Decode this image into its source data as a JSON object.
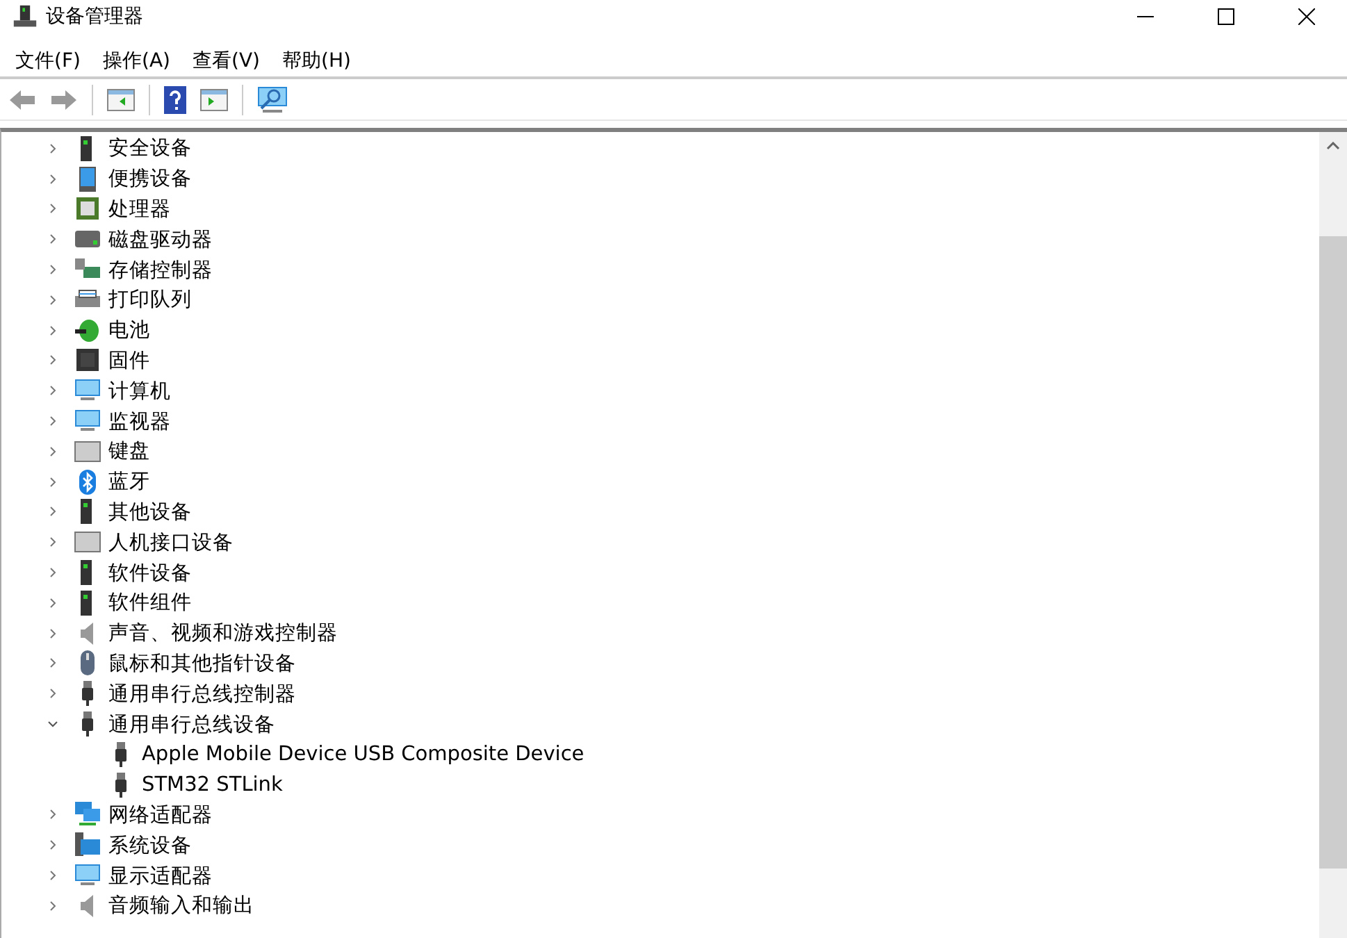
{
  "window": {
    "title": "设备管理器"
  },
  "menu": [
    "文件(F)",
    "操作(A)",
    "查看(V)",
    "帮助(H)"
  ],
  "tree": [
    {
      "label": "安全设备",
      "expanded": false
    },
    {
      "label": "便携设备",
      "expanded": false
    },
    {
      "label": "处理器",
      "expanded": false
    },
    {
      "label": "磁盘驱动器",
      "expanded": false
    },
    {
      "label": "存储控制器",
      "expanded": false
    },
    {
      "label": "打印队列",
      "expanded": false
    },
    {
      "label": "电池",
      "expanded": false
    },
    {
      "label": "固件",
      "expanded": false
    },
    {
      "label": "计算机",
      "expanded": false
    },
    {
      "label": "监视器",
      "expanded": false
    },
    {
      "label": "键盘",
      "expanded": false
    },
    {
      "label": "蓝牙",
      "expanded": false
    },
    {
      "label": "其他设备",
      "expanded": false
    },
    {
      "label": "人机接口设备",
      "expanded": false
    },
    {
      "label": "软件设备",
      "expanded": false
    },
    {
      "label": "软件组件",
      "expanded": false
    },
    {
      "label": "声音、视频和游戏控制器",
      "expanded": false
    },
    {
      "label": "鼠标和其他指针设备",
      "expanded": false
    },
    {
      "label": "通用串行总线控制器",
      "expanded": false
    },
    {
      "label": "通用串行总线设备",
      "expanded": true,
      "children": [
        {
          "label": "Apple Mobile Device USB Composite Device"
        },
        {
          "label": "STM32 STLink"
        }
      ]
    },
    {
      "label": "网络适配器",
      "expanded": false
    },
    {
      "label": "系统设备",
      "expanded": false
    },
    {
      "label": "显示适配器",
      "expanded": false
    },
    {
      "label": "音频输入和输出",
      "expanded": false
    }
  ]
}
